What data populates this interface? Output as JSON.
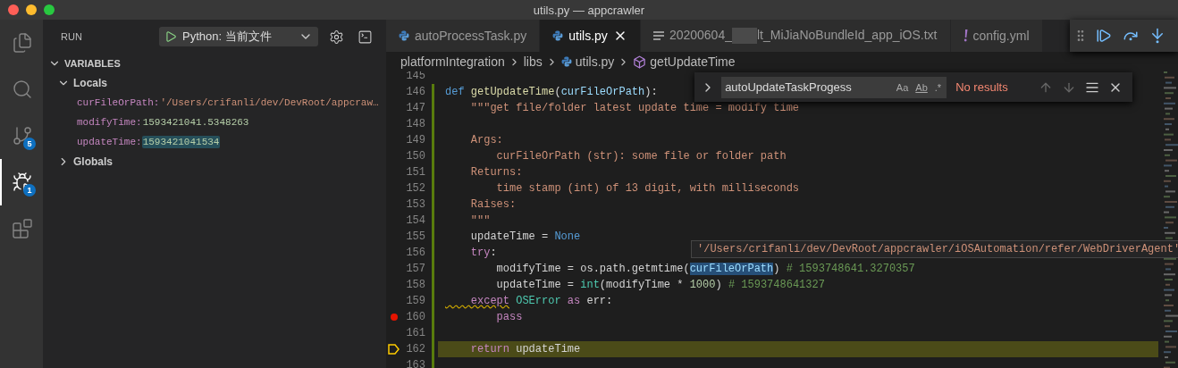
{
  "window": {
    "title": "utils.py — appcrawler"
  },
  "activity_bar": [
    {
      "kind": "explorer",
      "selected": false
    },
    {
      "kind": "search",
      "selected": false
    },
    {
      "kind": "scm",
      "selected": false,
      "badge": "5"
    },
    {
      "kind": "debug",
      "selected": true,
      "badge": "1"
    },
    {
      "kind": "extensions",
      "selected": false
    }
  ],
  "sidebar": {
    "title": "RUN",
    "launch_config": "Python: 当前文件",
    "sections": [
      {
        "label": "VARIABLES",
        "expanded": true,
        "children": [
          {
            "label": "Locals",
            "expanded": true,
            "children": [
              {
                "name": "curFileOrPath:",
                "value": "'/Users/crifanli/dev/DevRoot/appcraw…",
                "kind": "string",
                "changed": false
              },
              {
                "name": "modifyTime:",
                "value": "1593421041.5348263",
                "kind": "number",
                "changed": false
              },
              {
                "name": "updateTime:",
                "value": "1593421041534",
                "kind": "number",
                "changed": true
              }
            ]
          },
          {
            "label": "Globals",
            "expanded": false
          }
        ]
      }
    ]
  },
  "tabs": [
    {
      "label_parts": [
        "autoProcessTask.py"
      ],
      "kind": "python",
      "selected": false
    },
    {
      "label_parts": [
        "utils.py"
      ],
      "kind": "python",
      "selected": true
    },
    {
      "label_parts": [
        "20200604_",
        "lt_MiJiaNoBundleId_app_iOS.txt"
      ],
      "kind": "text",
      "selected": false
    },
    {
      "label_parts": [
        "config.yml"
      ],
      "kind": "yaml",
      "selected": false
    }
  ],
  "breadcrumb": [
    {
      "label": "platformIntegration",
      "kind": "folder"
    },
    {
      "label": "libs",
      "kind": "folder"
    },
    {
      "label": "utils.py",
      "kind": "python"
    },
    {
      "label": "getUpdateTime",
      "kind": "method"
    }
  ],
  "find_widget": {
    "query": "autoUpdateTaskProgess",
    "toggles": [
      {
        "label": "Aa",
        "on": false
      },
      {
        "label": "Ab",
        "on": false
      },
      {
        "label": ".*",
        "on": false
      }
    ],
    "result": "No results"
  },
  "hover": {
    "text": "'/Users/crifanli/dev/DevRoot/appcrawler/iOSAutomation/refer/WebDriverAgent'"
  },
  "code": [
    {
      "number": "145",
      "breakpoint": false,
      "current": false
    },
    {
      "number": "146",
      "breakpoint": false,
      "current": false,
      "tokens": [
        {
          "text": "def",
          "kind": "keyword"
        },
        {
          "text": " getUpdateTime",
          "kind": "function"
        },
        {
          "text": "(",
          "kind": "plain"
        },
        {
          "text": "curFileOrPath",
          "kind": "parameter"
        },
        {
          "text": "):",
          "kind": "plain"
        }
      ]
    },
    {
      "number": "147",
      "breakpoint": false,
      "current": false,
      "tokens": [
        {
          "text": "    \"\"\"get file/folder latest update time = modify time",
          "kind": "string"
        }
      ]
    },
    {
      "number": "148",
      "breakpoint": false,
      "current": false
    },
    {
      "number": "149",
      "breakpoint": false,
      "current": false,
      "tokens": [
        {
          "text": "    Args:",
          "kind": "string"
        }
      ]
    },
    {
      "number": "150",
      "breakpoint": false,
      "current": false,
      "tokens": [
        {
          "text": "        curFileOrPath (str): some file or folder path",
          "kind": "string"
        }
      ]
    },
    {
      "number": "151",
      "breakpoint": false,
      "current": false,
      "tokens": [
        {
          "text": "    Returns:",
          "kind": "string"
        }
      ]
    },
    {
      "number": "152",
      "breakpoint": false,
      "current": false,
      "tokens": [
        {
          "text": "        time stamp (int) of 13 digit, with milliseconds",
          "kind": "string"
        }
      ]
    },
    {
      "number": "153",
      "breakpoint": false,
      "current": false,
      "tokens": [
        {
          "text": "    Raises:",
          "kind": "string"
        }
      ]
    },
    {
      "number": "154",
      "breakpoint": false,
      "current": false,
      "tokens": [
        {
          "text": "    \"\"\"",
          "kind": "string"
        }
      ]
    },
    {
      "number": "155",
      "breakpoint": false,
      "current": false,
      "tokens": [
        {
          "text": "    updateTime = ",
          "kind": "plain"
        },
        {
          "text": "None",
          "kind": "keyword"
        }
      ]
    },
    {
      "number": "156",
      "breakpoint": false,
      "current": false,
      "tokens": [
        {
          "text": "    try",
          "kind": "control"
        },
        {
          "text": ":",
          "kind": "plain"
        }
      ]
    },
    {
      "number": "157",
      "breakpoint": false,
      "current": false,
      "tokens": [
        {
          "text": "        modifyTime = os.path.getmtime(",
          "kind": "plain"
        },
        {
          "text": "curFileOrPath",
          "kind": "hovered"
        },
        {
          "text": ") ",
          "kind": "plain"
        },
        {
          "text": "# 1593748641.3270357",
          "kind": "comment"
        }
      ]
    },
    {
      "number": "158",
      "breakpoint": false,
      "current": false,
      "tokens": [
        {
          "text": "        updateTime = ",
          "kind": "plain"
        },
        {
          "text": "int",
          "kind": "builtin"
        },
        {
          "text": "(modifyTime * ",
          "kind": "plain"
        },
        {
          "text": "1000",
          "kind": "number"
        },
        {
          "text": ") ",
          "kind": "plain"
        },
        {
          "text": "# 1593748641327",
          "kind": "comment"
        }
      ]
    },
    {
      "number": "159",
      "breakpoint": false,
      "current": false,
      "tokens": [
        {
          "text": "    except",
          "kind": "control_warning"
        },
        {
          "text": " OSError",
          "kind": "builtin"
        },
        {
          "text": " as",
          "kind": "control"
        },
        {
          "text": " err:",
          "kind": "plain"
        }
      ]
    },
    {
      "number": "160",
      "breakpoint": true,
      "current": false,
      "tokens": [
        {
          "text": "        pass",
          "kind": "control"
        }
      ]
    },
    {
      "number": "161",
      "breakpoint": false,
      "current": false
    },
    {
      "number": "162",
      "breakpoint": false,
      "current": true,
      "tokens": [
        {
          "text": "    return",
          "kind": "control"
        },
        {
          "text": " updateTime",
          "kind": "plain"
        }
      ]
    },
    {
      "number": "163",
      "breakpoint": false,
      "current": false
    }
  ]
}
